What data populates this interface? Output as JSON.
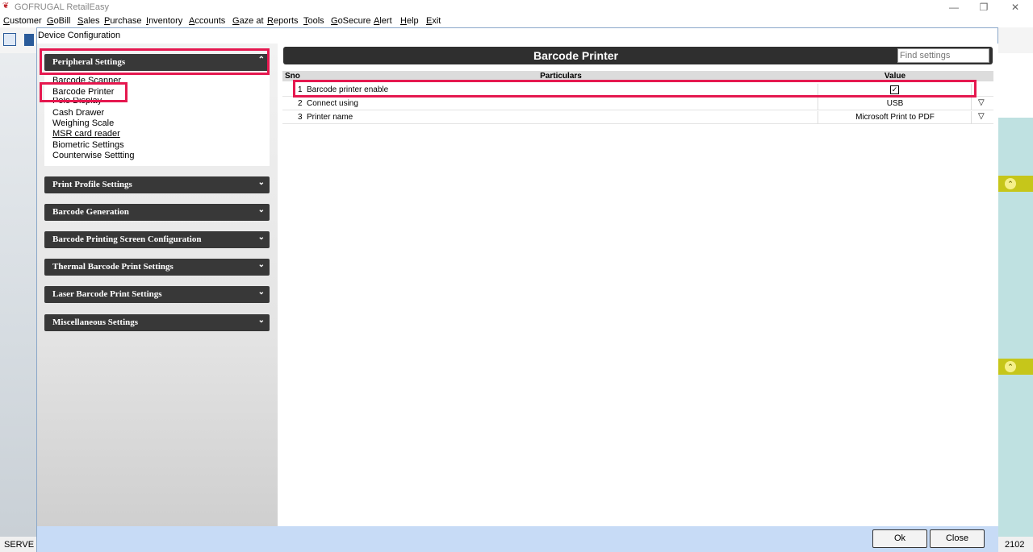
{
  "app": {
    "title": "GOFRUGAL RetailEasy"
  },
  "menu": [
    "Customer",
    "GoBill",
    "Sales",
    "Purchase",
    "Inventory",
    "Accounts",
    "Gaze at",
    "Reports",
    "Tools",
    "GoSecure",
    "Alert",
    "Help",
    "Exit"
  ],
  "dialog": {
    "title": "Device Configuration"
  },
  "sections": [
    {
      "label": "Peripheral Settings",
      "expanded": true
    },
    {
      "label": "Print Profile Settings",
      "expanded": false
    },
    {
      "label": "Barcode Generation",
      "expanded": false
    },
    {
      "label": "Barcode Printing Screen Configuration",
      "expanded": false
    },
    {
      "label": "Thermal Barcode Print Settings",
      "expanded": false
    },
    {
      "label": "Laser Barcode Print Settings",
      "expanded": false
    },
    {
      "label": "Miscellaneous Settings",
      "expanded": false
    }
  ],
  "peripheral_items": [
    "Barcode Scanner",
    "Barcode Printer",
    "Pole Display",
    "Cash Drawer",
    "Weighing Scale",
    "MSR card reader",
    "Biometric Settings",
    "Counterwise Settting"
  ],
  "selected_item": "Barcode Printer",
  "main": {
    "title": "Barcode Printer",
    "search_placeholder": "Find settings",
    "columns": {
      "sno": "Sno",
      "particulars": "Particulars",
      "value": "Value"
    },
    "rows": [
      {
        "sno": "1",
        "particulars": "Barcode printer enable",
        "value": "",
        "checked": true
      },
      {
        "sno": "2",
        "particulars": "Connect using",
        "value": "USB"
      },
      {
        "sno": "3",
        "particulars": "Printer name",
        "value": "Microsoft Print to PDF"
      }
    ]
  },
  "footer": {
    "ok": "Ok",
    "close": "Close"
  },
  "status": {
    "left": "SERVE",
    "right": "2102"
  },
  "colors": {
    "highlight": "#e5184f",
    "section_bg": "#383838",
    "footer_bg": "#c7dbf6"
  }
}
